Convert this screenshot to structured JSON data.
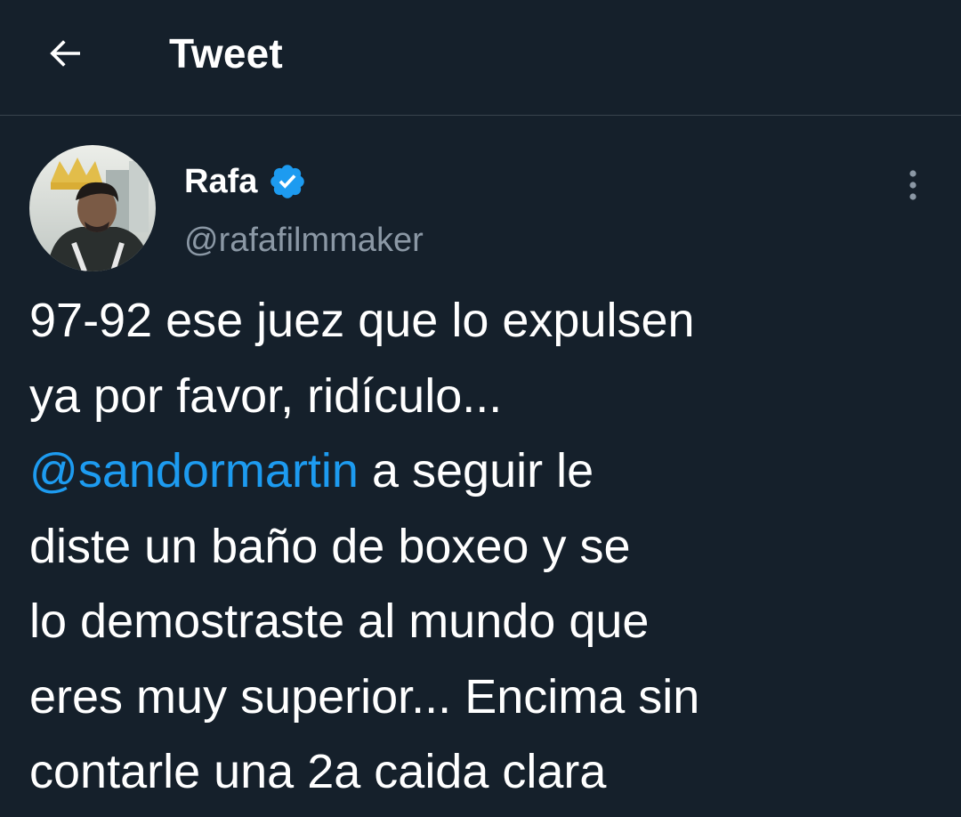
{
  "header": {
    "title": "Tweet",
    "back_icon": "arrow-left-icon"
  },
  "author": {
    "display_name": "Rafa",
    "handle": "@rafafilmmaker",
    "verified": true,
    "verified_icon": "verified-badge-icon"
  },
  "tweet": {
    "line1": "97-92 ese juez que lo expulsen",
    "line2": "ya por favor, ridículo...",
    "mention": "@sandormartin",
    "line3_rest": " a seguir le",
    "line4": "diste un baño de boxeo y se",
    "line5": "lo demostraste al mundo que",
    "line6": "eres muy superior... Encima sin",
    "line7": "contarle una 2a caida clara"
  },
  "colors": {
    "background": "#15202b",
    "accent": "#1d9bf0",
    "secondary_text": "#8b98a5",
    "divider": "#38444d"
  }
}
